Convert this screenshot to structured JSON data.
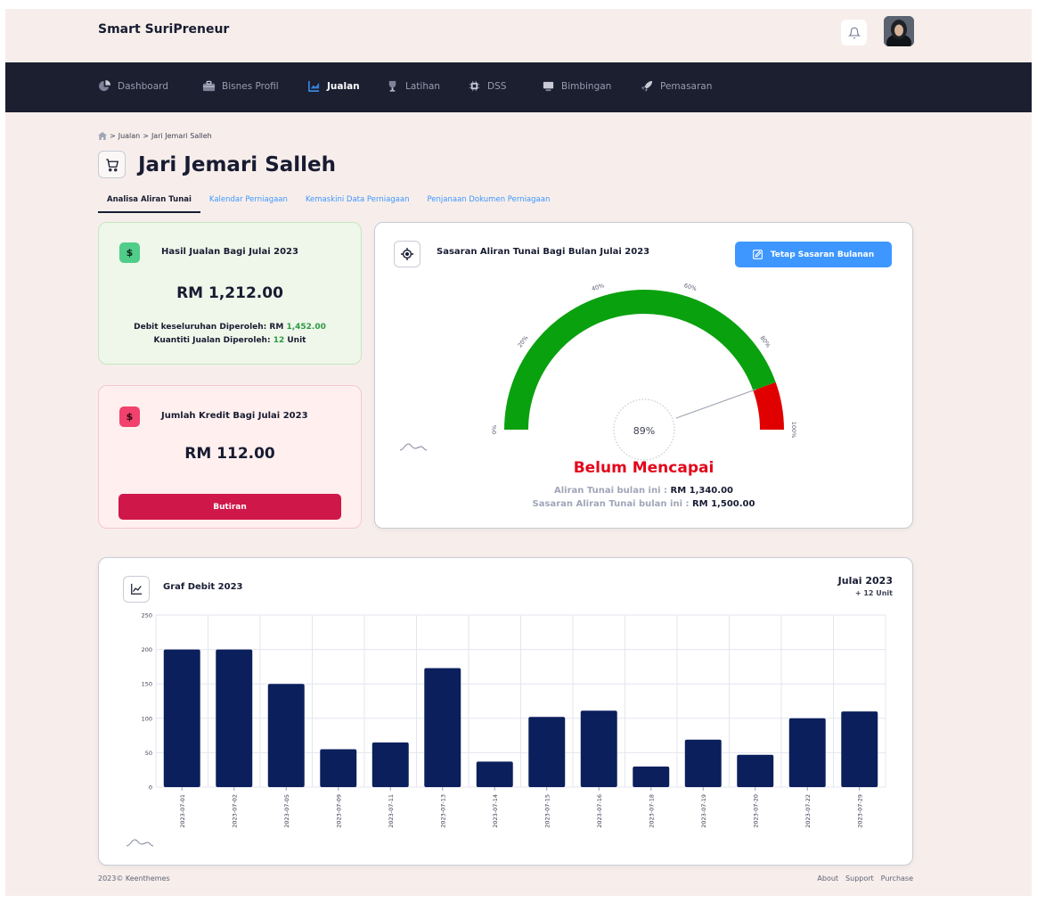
{
  "header": {
    "brand": "Smart SuriPreneur",
    "notification_icon": "bell-icon",
    "avatar": "user-avatar"
  },
  "nav": [
    {
      "label": "Dashboard",
      "icon": "pie-chart-icon",
      "active": false
    },
    {
      "label": "Bisnes Profil",
      "icon": "briefcase-icon",
      "active": false
    },
    {
      "label": "Jualan",
      "icon": "bar-chart-icon",
      "active": true
    },
    {
      "label": "Latihan",
      "icon": "trophy-icon",
      "active": false
    },
    {
      "label": "DSS",
      "icon": "cpu-icon",
      "active": false
    },
    {
      "label": "Bimbingan",
      "icon": "monitor-icon",
      "active": false
    },
    {
      "label": "Pemasaran",
      "icon": "rocket-icon",
      "active": false
    }
  ],
  "breadcrumb": {
    "sep1": ">",
    "item1": "Jualan",
    "sep2": ">",
    "item2": "Jari Jemari Salleh"
  },
  "page_title": "Jari Jemari Salleh",
  "tabs": [
    {
      "label": "Analisa Aliran Tunai",
      "active": true
    },
    {
      "label": "Kalendar Perniagaan",
      "active": false
    },
    {
      "label": "Kemaskini Data Perniagaan",
      "active": false
    },
    {
      "label": "Penjanaan Dokumen Perniagaan",
      "active": false
    }
  ],
  "sales_card": {
    "icon_text": "$",
    "title": "Hasil Jualan Bagi Julai 2023",
    "amount": "RM 1,212.00",
    "debit_label": "Debit keseluruhan Diperoleh: RM",
    "debit_value": "1,452.00",
    "qty_label": "Kuantiti Jualan Diperoleh:",
    "qty_value": "12",
    "qty_unit": "Unit"
  },
  "credit_card": {
    "icon_text": "$",
    "title": "Jumlah Kredit Bagi Julai 2023",
    "amount": "RM 112.00",
    "button": "Butiran"
  },
  "target_card": {
    "title": "Sasaran Aliran Tunai Bagi Bulan Julai 2023",
    "button": "Tetap Sasaran Bulanan",
    "gauge_value_text": "89%",
    "gauge_percent": 89,
    "gauge_ticks": [
      "0%",
      "20%",
      "40%",
      "60%",
      "80%",
      "100%"
    ],
    "status": "Belum Mencapai",
    "flow_label": "Aliran Tunai bulan ini :",
    "flow_value": "RM 1,340.00",
    "target_label": "Sasaran Aliran Tunai bulan ini :",
    "target_value": "RM 1,500.00",
    "colors": {
      "ok": "#0aa10f",
      "over": "#e00000"
    }
  },
  "graph_card": {
    "title": "Graf Debit 2023",
    "month": "Julai 2023",
    "units": "+ 12 Unit"
  },
  "chart_data": {
    "type": "bar",
    "categories": [
      "2023-07-01",
      "2023-07-02",
      "2023-07-05",
      "2023-07-09",
      "2023-07-11",
      "2023-07-13",
      "2023-07-14",
      "2023-07-15",
      "2023-07-16",
      "2023-07-18",
      "2023-07-19",
      "2023-07-20",
      "2023-07-22",
      "2023-07-29"
    ],
    "values": [
      200,
      200,
      150,
      55,
      65,
      173,
      37,
      102,
      111,
      30,
      69,
      47,
      100,
      110
    ],
    "ylim": [
      0,
      250
    ],
    "yticks": [
      0,
      50,
      100,
      150,
      200,
      250
    ],
    "color": "#0b1f5c",
    "grid": true
  },
  "footer": {
    "copyright": "2023© Keenthemes",
    "links": [
      "About",
      "Support",
      "Purchase"
    ]
  }
}
